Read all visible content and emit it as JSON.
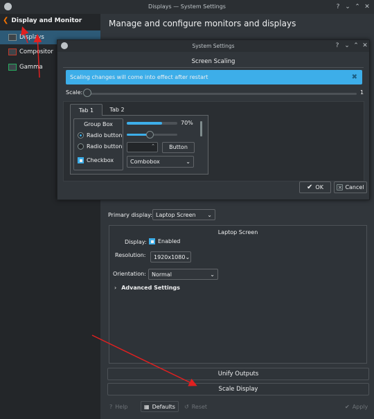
{
  "main_window": {
    "title": "Displays — System Settings",
    "controls": [
      "?",
      "⌄",
      "⌃",
      "✕"
    ]
  },
  "sidebar": {
    "header": "Display and Monitor",
    "items": [
      {
        "label": "Displays",
        "selected": true
      },
      {
        "label": "Compositor",
        "selected": false
      },
      {
        "label": "Gamma",
        "selected": false
      }
    ]
  },
  "content": {
    "title": "Manage and configure monitors and displays",
    "primary_display_label": "Primary display:",
    "primary_display_value": "Laptop Screen",
    "screen_panel_title": "Laptop Screen",
    "display_label": "Display:",
    "enabled_label": "Enabled",
    "resolution_label": "Resolution:",
    "resolution_value": "1920x1080",
    "orientation_label": "Orientation:",
    "orientation_value": "Normal",
    "advanced_settings": "Advanced Settings",
    "unify_outputs": "Unify Outputs",
    "scale_display": "Scale Display"
  },
  "bottom_bar": {
    "help": "Help",
    "defaults": "Defaults",
    "reset": "Reset",
    "apply": "Apply"
  },
  "dialog": {
    "title": "System Settings",
    "controls": [
      "?",
      "⌄",
      "⌃",
      "✕"
    ],
    "heading": "Screen Scaling",
    "info_message": "Scaling changes will come into effect after restart",
    "scale_label": "Scale:",
    "scale_value": "1",
    "tabs": [
      "Tab 1",
      "Tab 2"
    ],
    "group_box_title": "Group Box",
    "radio1": "Radio button",
    "radio2": "Radio button",
    "checkbox": "Checkbox",
    "progress": 0.7,
    "progress_label": "70%",
    "slider_value": 0.45,
    "button_label": "Button",
    "combobox_value": "Combobox",
    "ok": "OK",
    "cancel": "Cancel"
  },
  "colors": {
    "accent": "#3daee9",
    "window_bg": "#31363b",
    "sidebar_bg": "#232629",
    "annotation_red": "#e02020"
  }
}
